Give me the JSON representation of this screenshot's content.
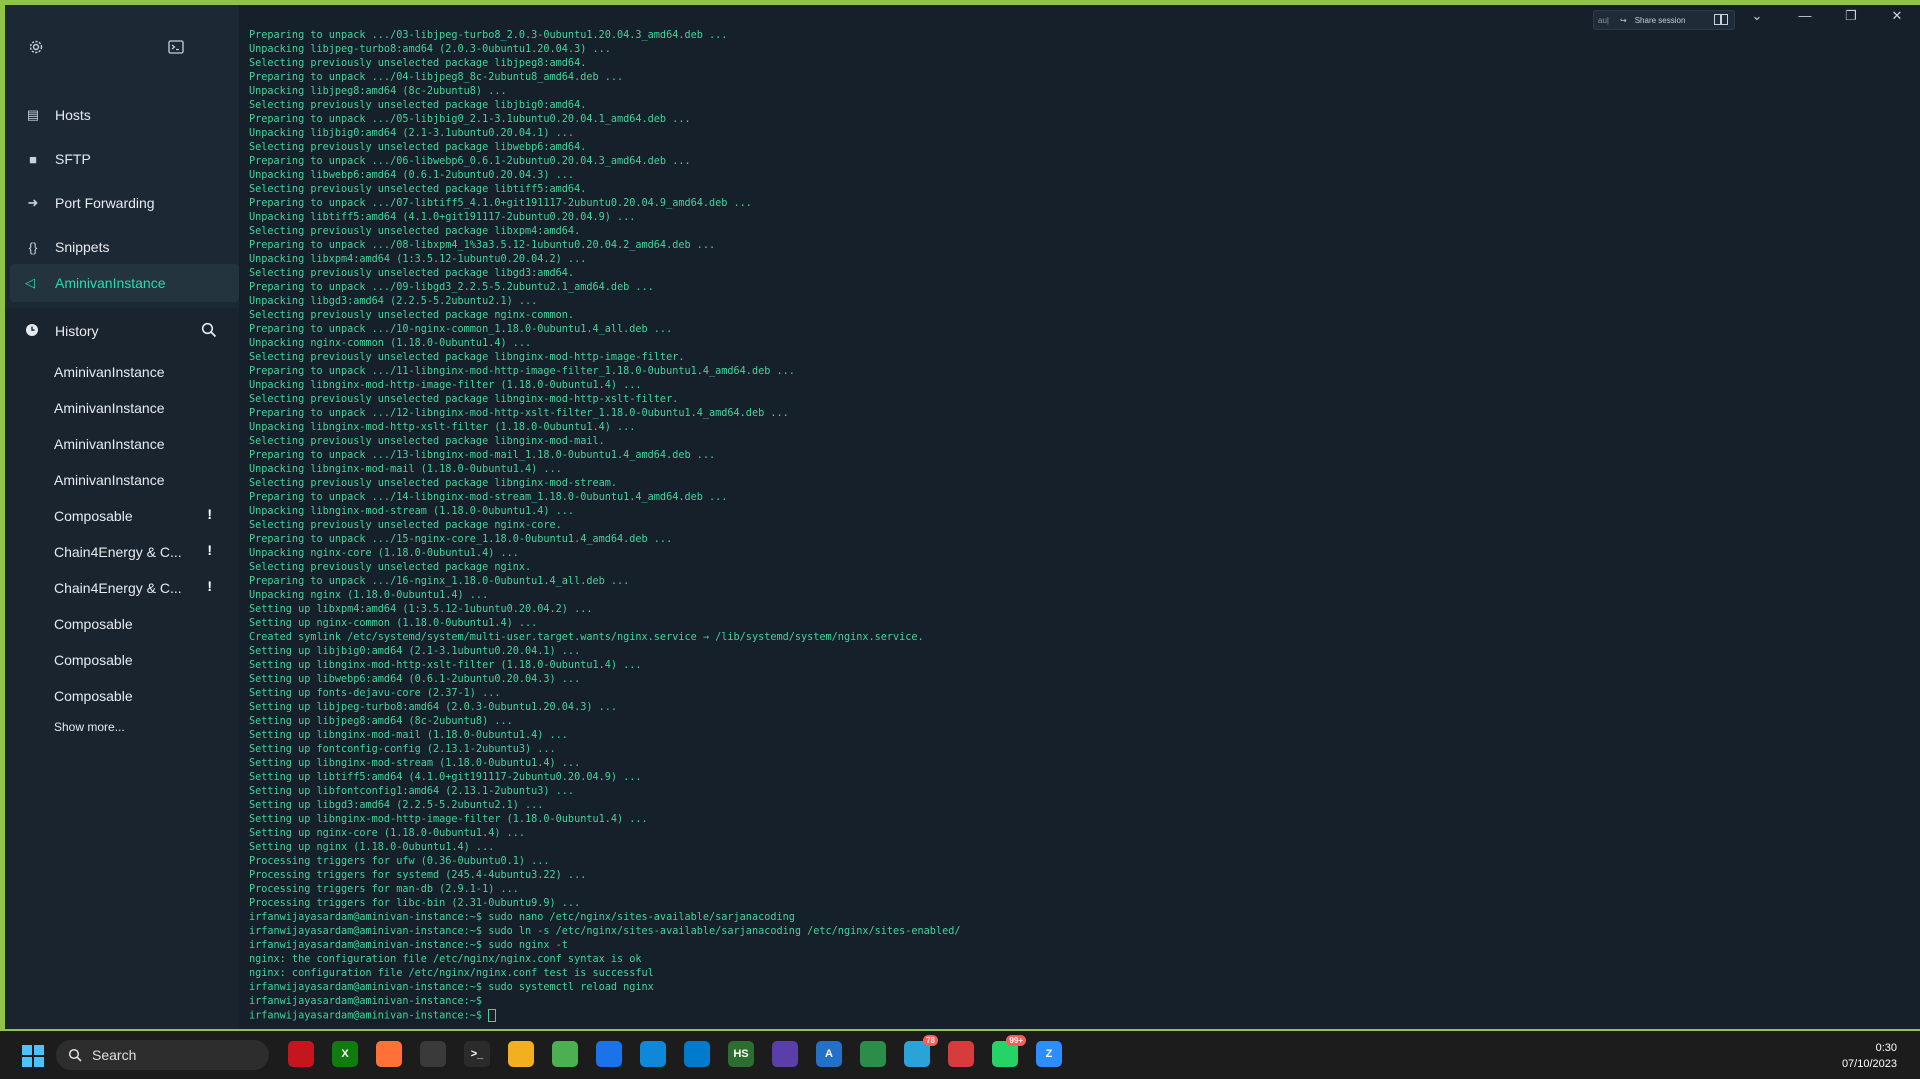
{
  "sidebar": {
    "nav": [
      {
        "label": "Hosts",
        "icon": "hosts-icon"
      },
      {
        "label": "SFTP",
        "icon": "folder-icon"
      },
      {
        "label": "Port Forwarding",
        "icon": "port-forward-icon"
      },
      {
        "label": "Snippets",
        "icon": "braces-icon"
      }
    ],
    "active_host": "AminivanInstance",
    "history_label": "History",
    "history": [
      {
        "label": "AminivanInstance",
        "warn": ""
      },
      {
        "label": "AminivanInstance",
        "warn": ""
      },
      {
        "label": "AminivanInstance",
        "warn": ""
      },
      {
        "label": "AminivanInstance",
        "warn": ""
      },
      {
        "label": "Composable",
        "warn": "!"
      },
      {
        "label": "Chain4Energy & C...",
        "warn": "!"
      },
      {
        "label": "Chain4Energy & C...",
        "warn": "!"
      },
      {
        "label": "Composable",
        "warn": ""
      },
      {
        "label": "Composable",
        "warn": ""
      },
      {
        "label": "Composable",
        "warn": ""
      }
    ],
    "show_more": "Show more..."
  },
  "topbar": {
    "au_label": "au|",
    "share_label": "Share session"
  },
  "terminal": {
    "lines": [
      "Preparing to unpack .../03-libjpeg-turbo8_2.0.3-0ubuntu1.20.04.3_amd64.deb ...",
      "Unpacking libjpeg-turbo8:amd64 (2.0.3-0ubuntu1.20.04.3) ...",
      "Selecting previously unselected package libjpeg8:amd64.",
      "Preparing to unpack .../04-libjpeg8_8c-2ubuntu8_amd64.deb ...",
      "Unpacking libjpeg8:amd64 (8c-2ubuntu8) ...",
      "Selecting previously unselected package libjbig0:amd64.",
      "Preparing to unpack .../05-libjbig0_2.1-3.1ubuntu0.20.04.1_amd64.deb ...",
      "Unpacking libjbig0:amd64 (2.1-3.1ubuntu0.20.04.1) ...",
      "Selecting previously unselected package libwebp6:amd64.",
      "Preparing to unpack .../06-libwebp6_0.6.1-2ubuntu0.20.04.3_amd64.deb ...",
      "Unpacking libwebp6:amd64 (0.6.1-2ubuntu0.20.04.3) ...",
      "Selecting previously unselected package libtiff5:amd64.",
      "Preparing to unpack .../07-libtiff5_4.1.0+git191117-2ubuntu0.20.04.9_amd64.deb ...",
      "Unpacking libtiff5:amd64 (4.1.0+git191117-2ubuntu0.20.04.9) ...",
      "Selecting previously unselected package libxpm4:amd64.",
      "Preparing to unpack .../08-libxpm4_1%3a3.5.12-1ubuntu0.20.04.2_amd64.deb ...",
      "Unpacking libxpm4:amd64 (1:3.5.12-1ubuntu0.20.04.2) ...",
      "Selecting previously unselected package libgd3:amd64.",
      "Preparing to unpack .../09-libgd3_2.2.5-5.2ubuntu2.1_amd64.deb ...",
      "Unpacking libgd3:amd64 (2.2.5-5.2ubuntu2.1) ...",
      "Selecting previously unselected package nginx-common.",
      "Preparing to unpack .../10-nginx-common_1.18.0-0ubuntu1.4_all.deb ...",
      "Unpacking nginx-common (1.18.0-0ubuntu1.4) ...",
      "Selecting previously unselected package libnginx-mod-http-image-filter.",
      "Preparing to unpack .../11-libnginx-mod-http-image-filter_1.18.0-0ubuntu1.4_amd64.deb ...",
      "Unpacking libnginx-mod-http-image-filter (1.18.0-0ubuntu1.4) ...",
      "Selecting previously unselected package libnginx-mod-http-xslt-filter.",
      "Preparing to unpack .../12-libnginx-mod-http-xslt-filter_1.18.0-0ubuntu1.4_amd64.deb ...",
      "Unpacking libnginx-mod-http-xslt-filter (1.18.0-0ubuntu1.4) ...",
      "Selecting previously unselected package libnginx-mod-mail.",
      "Preparing to unpack .../13-libnginx-mod-mail_1.18.0-0ubuntu1.4_amd64.deb ...",
      "Unpacking libnginx-mod-mail (1.18.0-0ubuntu1.4) ...",
      "Selecting previously unselected package libnginx-mod-stream.",
      "Preparing to unpack .../14-libnginx-mod-stream_1.18.0-0ubuntu1.4_amd64.deb ...",
      "Unpacking libnginx-mod-stream (1.18.0-0ubuntu1.4) ...",
      "Selecting previously unselected package nginx-core.",
      "Preparing to unpack .../15-nginx-core_1.18.0-0ubuntu1.4_amd64.deb ...",
      "Unpacking nginx-core (1.18.0-0ubuntu1.4) ...",
      "Selecting previously unselected package nginx.",
      "Preparing to unpack .../16-nginx_1.18.0-0ubuntu1.4_all.deb ...",
      "Unpacking nginx (1.18.0-0ubuntu1.4) ...",
      "Setting up libxpm4:amd64 (1:3.5.12-1ubuntu0.20.04.2) ...",
      "Setting up nginx-common (1.18.0-0ubuntu1.4) ...",
      "Created symlink /etc/systemd/system/multi-user.target.wants/nginx.service → /lib/systemd/system/nginx.service.",
      "Setting up libjbig0:amd64 (2.1-3.1ubuntu0.20.04.1) ...",
      "Setting up libnginx-mod-http-xslt-filter (1.18.0-0ubuntu1.4) ...",
      "Setting up libwebp6:amd64 (0.6.1-2ubuntu0.20.04.3) ...",
      "Setting up fonts-dejavu-core (2.37-1) ...",
      "Setting up libjpeg-turbo8:amd64 (2.0.3-0ubuntu1.20.04.3) ...",
      "Setting up libjpeg8:amd64 (8c-2ubuntu8) ...",
      "Setting up libnginx-mod-mail (1.18.0-0ubuntu1.4) ...",
      "Setting up fontconfig-config (2.13.1-2ubuntu3) ...",
      "Setting up libnginx-mod-stream (1.18.0-0ubuntu1.4) ...",
      "Setting up libtiff5:amd64 (4.1.0+git191117-2ubuntu0.20.04.9) ...",
      "Setting up libfontconfig1:amd64 (2.13.1-2ubuntu3) ...",
      "Setting up libgd3:amd64 (2.2.5-5.2ubuntu2.1) ...",
      "Setting up libnginx-mod-http-image-filter (1.18.0-0ubuntu1.4) ...",
      "Setting up nginx-core (1.18.0-0ubuntu1.4) ...",
      "Setting up nginx (1.18.0-0ubuntu1.4) ...",
      "Processing triggers for ufw (0.36-0ubuntu0.1) ...",
      "Processing triggers for systemd (245.4-4ubuntu3.22) ...",
      "Processing triggers for man-db (2.9.1-1) ...",
      "Processing triggers for libc-bin (2.31-0ubuntu9.9) ...",
      "irfanwijayasardam@aminivan-instance:~$ sudo nano /etc/nginx/sites-available/sarjanacoding",
      "irfanwijayasardam@aminivan-instance:~$ sudo ln -s /etc/nginx/sites-available/sarjanacoding /etc/nginx/sites-enabled/",
      "irfanwijayasardam@aminivan-instance:~$ sudo nginx -t",
      "nginx: the configuration file /etc/nginx/nginx.conf syntax is ok",
      "nginx: configuration file /etc/nginx/nginx.conf test is successful",
      "irfanwijayasardam@aminivan-instance:~$ sudo systemctl reload nginx",
      "irfanwijayasardam@aminivan-instance:~$",
      "irfanwijayasardam@aminivan-instance:~$ "
    ]
  },
  "taskbar": {
    "search_placeholder": "Search",
    "apps": [
      {
        "name": "mixed-reality-icon",
        "label": "",
        "color": "#c4161c"
      },
      {
        "name": "xbox-icon",
        "label": "X",
        "color": "#107c10"
      },
      {
        "name": "firefox-icon",
        "label": "",
        "color": "#ff7139"
      },
      {
        "name": "app-circle-icon",
        "label": "",
        "color": "#3a3a3a"
      },
      {
        "name": "terminal-icon",
        "label": ">_",
        "color": "#2b2b2b"
      },
      {
        "name": "file-explorer-icon",
        "label": "",
        "color": "#f2b01e"
      },
      {
        "name": "notepad-icon",
        "label": "",
        "color": "#4caf50"
      },
      {
        "name": "chrome-icon",
        "label": "",
        "color": "#1a73e8"
      },
      {
        "name": "edge-icon",
        "label": "",
        "color": "#0f88d8"
      },
      {
        "name": "vscode-icon",
        "label": "",
        "color": "#007acc"
      },
      {
        "name": "hs-app-icon",
        "label": "HS",
        "color": "#2c6e2f"
      },
      {
        "name": "eclipse-icon",
        "label": "",
        "color": "#5b3fa8"
      },
      {
        "name": "azure-icon",
        "label": "A",
        "color": "#2470c7"
      },
      {
        "name": "xbox-circle-icon",
        "label": "",
        "color": "#2c8c4a"
      },
      {
        "name": "telegram-icon",
        "label": "",
        "color": "#2aa3d9",
        "badge": "78"
      },
      {
        "name": "termius-icon",
        "label": "",
        "color": "#d83b3b"
      },
      {
        "name": "whatsapp-icon",
        "label": "",
        "color": "#25d366",
        "badge": "99+"
      },
      {
        "name": "zoom-icon",
        "label": "Z",
        "color": "#2d8cff"
      }
    ],
    "time": "0:30",
    "date": "07/10/2023"
  },
  "colors": {
    "accent": "#2fd6b0",
    "terminal_text": "#45d39a",
    "background": "#15202b",
    "border": "#8fc34a"
  }
}
